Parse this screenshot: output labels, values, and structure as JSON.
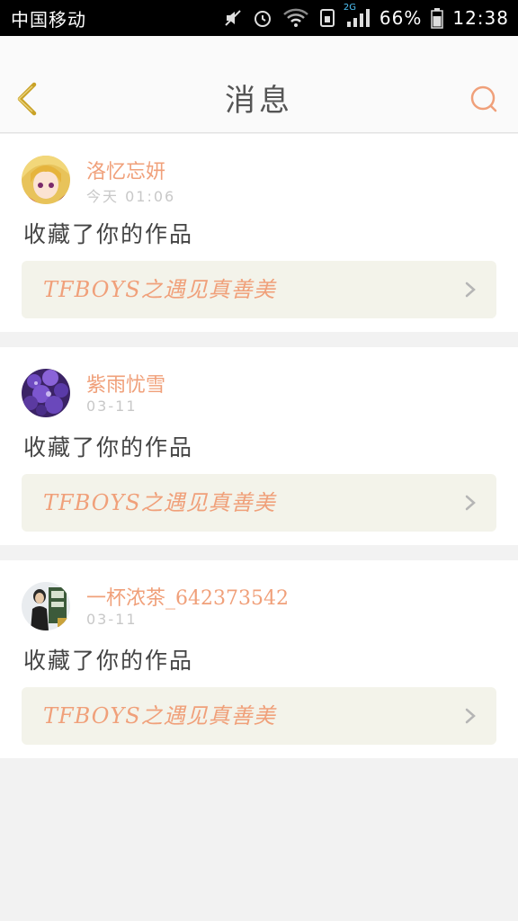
{
  "status_bar": {
    "carrier": "中国移动",
    "network": "2G",
    "battery": "66%",
    "time": "12:38"
  },
  "header": {
    "title": "消息"
  },
  "colors": {
    "accent": "#f0a07a",
    "back_arrow": "#c9a227",
    "card_link_bg": "#f3f3ea",
    "page_bg": "#f2f2f2"
  },
  "messages": [
    {
      "username": "洛忆忘妍",
      "time": "今天 01:06",
      "action": "收藏了你的作品",
      "work_title": "TFBOYS之遇见真善美",
      "avatar_icon": "anime-girl-avatar"
    },
    {
      "username": "紫雨忧雪",
      "time": "03-11",
      "action": "收藏了你的作品",
      "work_title": "TFBOYS之遇见真善美",
      "avatar_icon": "purple-flowers-avatar"
    },
    {
      "username": "一杯浓茶_642373542",
      "time": "03-11",
      "action": "收藏了你的作品",
      "work_title": "TFBOYS之遇见真善美",
      "avatar_icon": "person-photo-avatar"
    }
  ]
}
